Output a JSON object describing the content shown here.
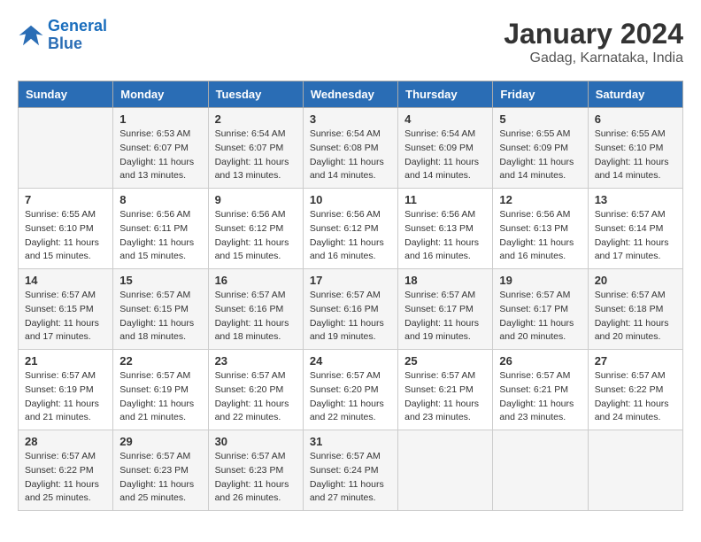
{
  "logo": {
    "text_general": "General",
    "text_blue": "Blue"
  },
  "header": {
    "month": "January 2024",
    "location": "Gadag, Karnataka, India"
  },
  "weekdays": [
    "Sunday",
    "Monday",
    "Tuesday",
    "Wednesday",
    "Thursday",
    "Friday",
    "Saturday"
  ],
  "weeks": [
    [
      {
        "day": "",
        "sunrise": "",
        "sunset": "",
        "daylight": ""
      },
      {
        "day": "1",
        "sunrise": "Sunrise: 6:53 AM",
        "sunset": "Sunset: 6:07 PM",
        "daylight": "Daylight: 11 hours and 13 minutes."
      },
      {
        "day": "2",
        "sunrise": "Sunrise: 6:54 AM",
        "sunset": "Sunset: 6:07 PM",
        "daylight": "Daylight: 11 hours and 13 minutes."
      },
      {
        "day": "3",
        "sunrise": "Sunrise: 6:54 AM",
        "sunset": "Sunset: 6:08 PM",
        "daylight": "Daylight: 11 hours and 14 minutes."
      },
      {
        "day": "4",
        "sunrise": "Sunrise: 6:54 AM",
        "sunset": "Sunset: 6:09 PM",
        "daylight": "Daylight: 11 hours and 14 minutes."
      },
      {
        "day": "5",
        "sunrise": "Sunrise: 6:55 AM",
        "sunset": "Sunset: 6:09 PM",
        "daylight": "Daylight: 11 hours and 14 minutes."
      },
      {
        "day": "6",
        "sunrise": "Sunrise: 6:55 AM",
        "sunset": "Sunset: 6:10 PM",
        "daylight": "Daylight: 11 hours and 14 minutes."
      }
    ],
    [
      {
        "day": "7",
        "sunrise": "Sunrise: 6:55 AM",
        "sunset": "Sunset: 6:10 PM",
        "daylight": "Daylight: 11 hours and 15 minutes."
      },
      {
        "day": "8",
        "sunrise": "Sunrise: 6:56 AM",
        "sunset": "Sunset: 6:11 PM",
        "daylight": "Daylight: 11 hours and 15 minutes."
      },
      {
        "day": "9",
        "sunrise": "Sunrise: 6:56 AM",
        "sunset": "Sunset: 6:12 PM",
        "daylight": "Daylight: 11 hours and 15 minutes."
      },
      {
        "day": "10",
        "sunrise": "Sunrise: 6:56 AM",
        "sunset": "Sunset: 6:12 PM",
        "daylight": "Daylight: 11 hours and 16 minutes."
      },
      {
        "day": "11",
        "sunrise": "Sunrise: 6:56 AM",
        "sunset": "Sunset: 6:13 PM",
        "daylight": "Daylight: 11 hours and 16 minutes."
      },
      {
        "day": "12",
        "sunrise": "Sunrise: 6:56 AM",
        "sunset": "Sunset: 6:13 PM",
        "daylight": "Daylight: 11 hours and 16 minutes."
      },
      {
        "day": "13",
        "sunrise": "Sunrise: 6:57 AM",
        "sunset": "Sunset: 6:14 PM",
        "daylight": "Daylight: 11 hours and 17 minutes."
      }
    ],
    [
      {
        "day": "14",
        "sunrise": "Sunrise: 6:57 AM",
        "sunset": "Sunset: 6:15 PM",
        "daylight": "Daylight: 11 hours and 17 minutes."
      },
      {
        "day": "15",
        "sunrise": "Sunrise: 6:57 AM",
        "sunset": "Sunset: 6:15 PM",
        "daylight": "Daylight: 11 hours and 18 minutes."
      },
      {
        "day": "16",
        "sunrise": "Sunrise: 6:57 AM",
        "sunset": "Sunset: 6:16 PM",
        "daylight": "Daylight: 11 hours and 18 minutes."
      },
      {
        "day": "17",
        "sunrise": "Sunrise: 6:57 AM",
        "sunset": "Sunset: 6:16 PM",
        "daylight": "Daylight: 11 hours and 19 minutes."
      },
      {
        "day": "18",
        "sunrise": "Sunrise: 6:57 AM",
        "sunset": "Sunset: 6:17 PM",
        "daylight": "Daylight: 11 hours and 19 minutes."
      },
      {
        "day": "19",
        "sunrise": "Sunrise: 6:57 AM",
        "sunset": "Sunset: 6:17 PM",
        "daylight": "Daylight: 11 hours and 20 minutes."
      },
      {
        "day": "20",
        "sunrise": "Sunrise: 6:57 AM",
        "sunset": "Sunset: 6:18 PM",
        "daylight": "Daylight: 11 hours and 20 minutes."
      }
    ],
    [
      {
        "day": "21",
        "sunrise": "Sunrise: 6:57 AM",
        "sunset": "Sunset: 6:19 PM",
        "daylight": "Daylight: 11 hours and 21 minutes."
      },
      {
        "day": "22",
        "sunrise": "Sunrise: 6:57 AM",
        "sunset": "Sunset: 6:19 PM",
        "daylight": "Daylight: 11 hours and 21 minutes."
      },
      {
        "day": "23",
        "sunrise": "Sunrise: 6:57 AM",
        "sunset": "Sunset: 6:20 PM",
        "daylight": "Daylight: 11 hours and 22 minutes."
      },
      {
        "day": "24",
        "sunrise": "Sunrise: 6:57 AM",
        "sunset": "Sunset: 6:20 PM",
        "daylight": "Daylight: 11 hours and 22 minutes."
      },
      {
        "day": "25",
        "sunrise": "Sunrise: 6:57 AM",
        "sunset": "Sunset: 6:21 PM",
        "daylight": "Daylight: 11 hours and 23 minutes."
      },
      {
        "day": "26",
        "sunrise": "Sunrise: 6:57 AM",
        "sunset": "Sunset: 6:21 PM",
        "daylight": "Daylight: 11 hours and 23 minutes."
      },
      {
        "day": "27",
        "sunrise": "Sunrise: 6:57 AM",
        "sunset": "Sunset: 6:22 PM",
        "daylight": "Daylight: 11 hours and 24 minutes."
      }
    ],
    [
      {
        "day": "28",
        "sunrise": "Sunrise: 6:57 AM",
        "sunset": "Sunset: 6:22 PM",
        "daylight": "Daylight: 11 hours and 25 minutes."
      },
      {
        "day": "29",
        "sunrise": "Sunrise: 6:57 AM",
        "sunset": "Sunset: 6:23 PM",
        "daylight": "Daylight: 11 hours and 25 minutes."
      },
      {
        "day": "30",
        "sunrise": "Sunrise: 6:57 AM",
        "sunset": "Sunset: 6:23 PM",
        "daylight": "Daylight: 11 hours and 26 minutes."
      },
      {
        "day": "31",
        "sunrise": "Sunrise: 6:57 AM",
        "sunset": "Sunset: 6:24 PM",
        "daylight": "Daylight: 11 hours and 27 minutes."
      },
      {
        "day": "",
        "sunrise": "",
        "sunset": "",
        "daylight": ""
      },
      {
        "day": "",
        "sunrise": "",
        "sunset": "",
        "daylight": ""
      },
      {
        "day": "",
        "sunrise": "",
        "sunset": "",
        "daylight": ""
      }
    ]
  ]
}
